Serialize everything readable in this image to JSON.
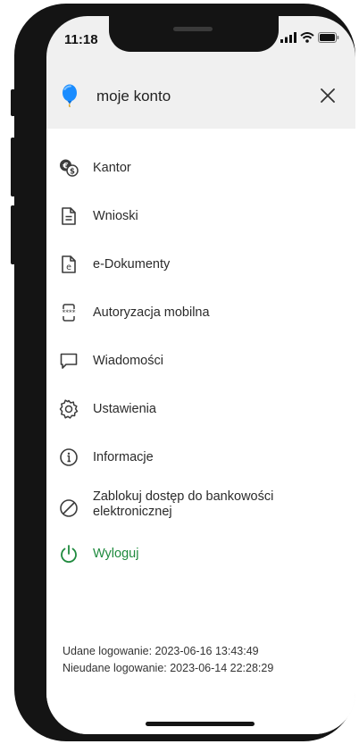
{
  "status_bar": {
    "time": "11:18",
    "icons": [
      "signal-icon",
      "wifi-icon",
      "battery-icon"
    ]
  },
  "header": {
    "title": "moje konto",
    "logo_icon": "balloon-logo-icon",
    "close_icon": "close-icon"
  },
  "menu": {
    "items": [
      {
        "label": "Kantor",
        "icon": "currency-exchange-icon"
      },
      {
        "label": "Wnioski",
        "icon": "document-icon"
      },
      {
        "label": "e-Dokumenty",
        "icon": "e-document-icon"
      },
      {
        "label": "Autoryzacja mobilna",
        "icon": "mobile-authorization-icon"
      },
      {
        "label": "Wiadomości",
        "icon": "message-icon"
      },
      {
        "label": "Ustawienia",
        "icon": "gear-icon"
      },
      {
        "label": "Informacje",
        "icon": "info-icon"
      },
      {
        "label": "Zablokuj dostęp do bankowości elektronicznej",
        "icon": "block-icon"
      },
      {
        "label": "Wyloguj",
        "icon": "power-icon"
      }
    ]
  },
  "login_info": {
    "success": "Udane logowanie: 2023-06-16 13:43:49",
    "failure": "Nieudane logowanie: 2023-06-14 22:28:29"
  },
  "colors": {
    "logout": "#1f8a3e",
    "logo": "#1a8cff",
    "header_bg": "#f0f0f0",
    "frame": "#141414"
  }
}
